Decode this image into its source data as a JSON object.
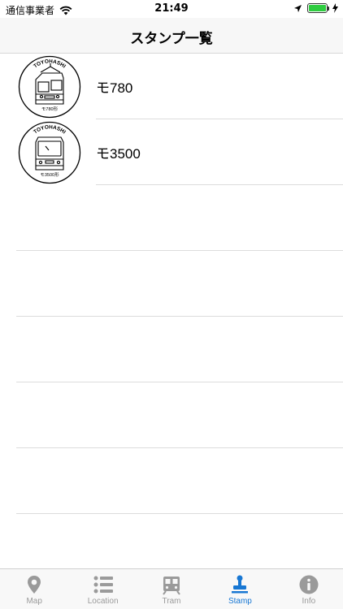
{
  "status_bar": {
    "carrier": "通信事業者",
    "time": "21:49",
    "battery_percent": 100
  },
  "nav": {
    "title": "スタンプ一覧"
  },
  "stamps": [
    {
      "label": "モ780",
      "stamp_top_text": "TOYOHASHI",
      "stamp_bottom_text": "モ780形"
    },
    {
      "label": "モ3500",
      "stamp_top_text": "TOYOHASHI",
      "stamp_bottom_text": "モ3500形"
    }
  ],
  "tabs": [
    {
      "label": "Map",
      "icon": "map-pin-icon",
      "active": false
    },
    {
      "label": "Location",
      "icon": "list-icon",
      "active": false
    },
    {
      "label": "Tram",
      "icon": "tram-icon",
      "active": false
    },
    {
      "label": "Stamp",
      "icon": "stamp-icon",
      "active": true
    },
    {
      "label": "Info",
      "icon": "info-icon",
      "active": false
    }
  ],
  "colors": {
    "accent": "#1877d3",
    "inactive": "#9a9a9a",
    "battery": "#2ecc40"
  }
}
